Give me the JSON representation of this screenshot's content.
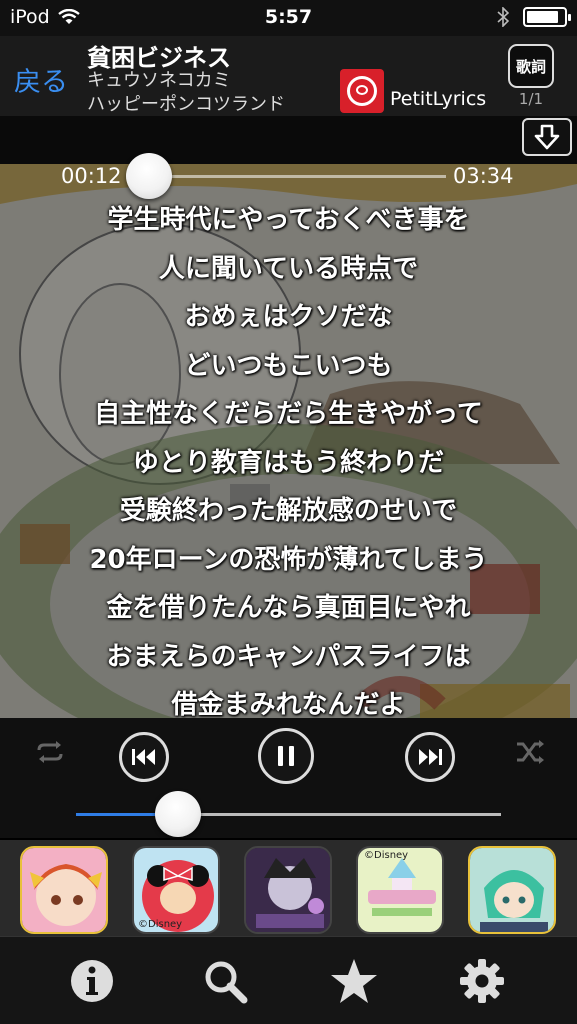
{
  "status_bar": {
    "carrier": "iPod",
    "time": "5:57",
    "battery_level": 0.85
  },
  "header": {
    "back_label": "戻る",
    "song_title": "貧困ビジネス",
    "artist": "キュウソネコカミ",
    "album": "ハッピーポンコツランド",
    "provider": "PetitLyrics",
    "lyrics_button": "歌詞",
    "page_indicator": "1/1"
  },
  "player": {
    "elapsed": "00:12",
    "total": "03:34",
    "progress": 0.06,
    "volume": 0.24,
    "accent_color": "#2f7de6"
  },
  "lyrics": [
    "学生時代にやっておくべき事を",
    "人に聞いている時点で",
    "おめぇはクソだな",
    "どいつもこいつも",
    "自主性なくだらだら生きやがって",
    "ゆとり教育はもう終わりだ",
    "受験終わった解放感のせいで",
    "20年ローンの恐怖が薄れてしまう",
    "金を借りたんなら真面目にやれ",
    "おまえらのキャンパスライフは",
    "借金まみれなんだよ"
  ],
  "ads": [
    {
      "icon": "anime-girl-app-icon",
      "caption": ""
    },
    {
      "icon": "minnie-mouse-app-icon",
      "caption": "©Disney"
    },
    {
      "icon": "divine-gate-app-icon",
      "caption": ""
    },
    {
      "icon": "magic-castle-app-icon",
      "caption": "©Disney"
    },
    {
      "icon": "anime-green-hair-app-icon",
      "caption": ""
    }
  ],
  "tabs": [
    {
      "icon": "info-icon"
    },
    {
      "icon": "search-icon"
    },
    {
      "icon": "star-icon"
    },
    {
      "icon": "gear-icon"
    }
  ]
}
